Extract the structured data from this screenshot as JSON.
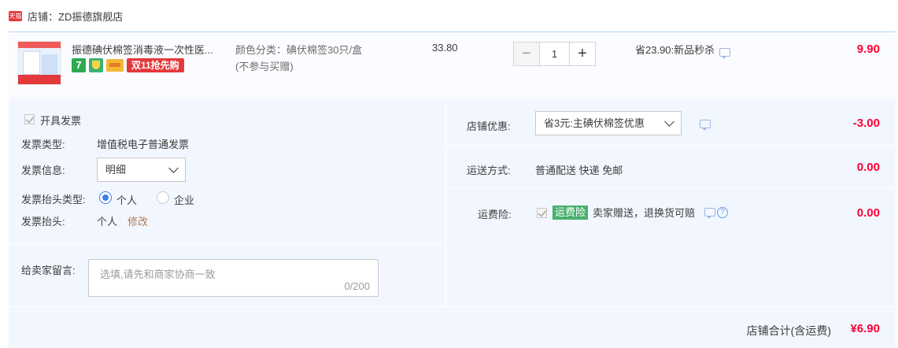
{
  "shop": {
    "badge_text": "天猫",
    "label": "店铺：ZD振德旗舰店"
  },
  "item": {
    "title": "振德碘伏棉签消毒液一次性医...",
    "badges": {
      "seven": "7",
      "double11": "双11抢先购"
    },
    "spec_line1": "颜色分类：碘伏棉签30只/盒",
    "spec_line2": "(不参与买赠)",
    "unit_price": "33.80",
    "quantity": "1",
    "minus": "−",
    "plus": "+",
    "promo": "省23.90:新品秒杀",
    "subtotal": "9.90"
  },
  "invoice": {
    "checkbox_label": "开具发票",
    "type_label": "发票类型:",
    "type_value": "增值税电子普通发票",
    "info_label": "发票信息:",
    "info_value": "明细",
    "header_type_label": "发票抬头类型:",
    "header_type_options": [
      "个人",
      "企业"
    ],
    "header_label": "发票抬头:",
    "header_value": "个人",
    "edit_link": "修改"
  },
  "message": {
    "label": "给卖家留言:",
    "placeholder": "选填,请先和商家协商一致",
    "counter": "0/200"
  },
  "shop_discount": {
    "label": "店铺优惠:",
    "selected": "省3元:主碘伏棉签优惠",
    "amount": "-3.00"
  },
  "delivery": {
    "label": "运送方式:",
    "value": "普通配送 快递 免邮",
    "amount": "0.00"
  },
  "freight_insurance": {
    "label": "运费险:",
    "tag": "运费险",
    "text": "卖家赠送，退换货可赔",
    "help": "?",
    "amount": "0.00"
  },
  "total": {
    "label": "店铺合计(含运费)",
    "amount": "¥6.90"
  },
  "colors": {
    "accent_red": "#ff0036",
    "radio_blue": "#3f7ee8",
    "panel_bg": "#f2f7ff",
    "link": "#b07a4f"
  }
}
